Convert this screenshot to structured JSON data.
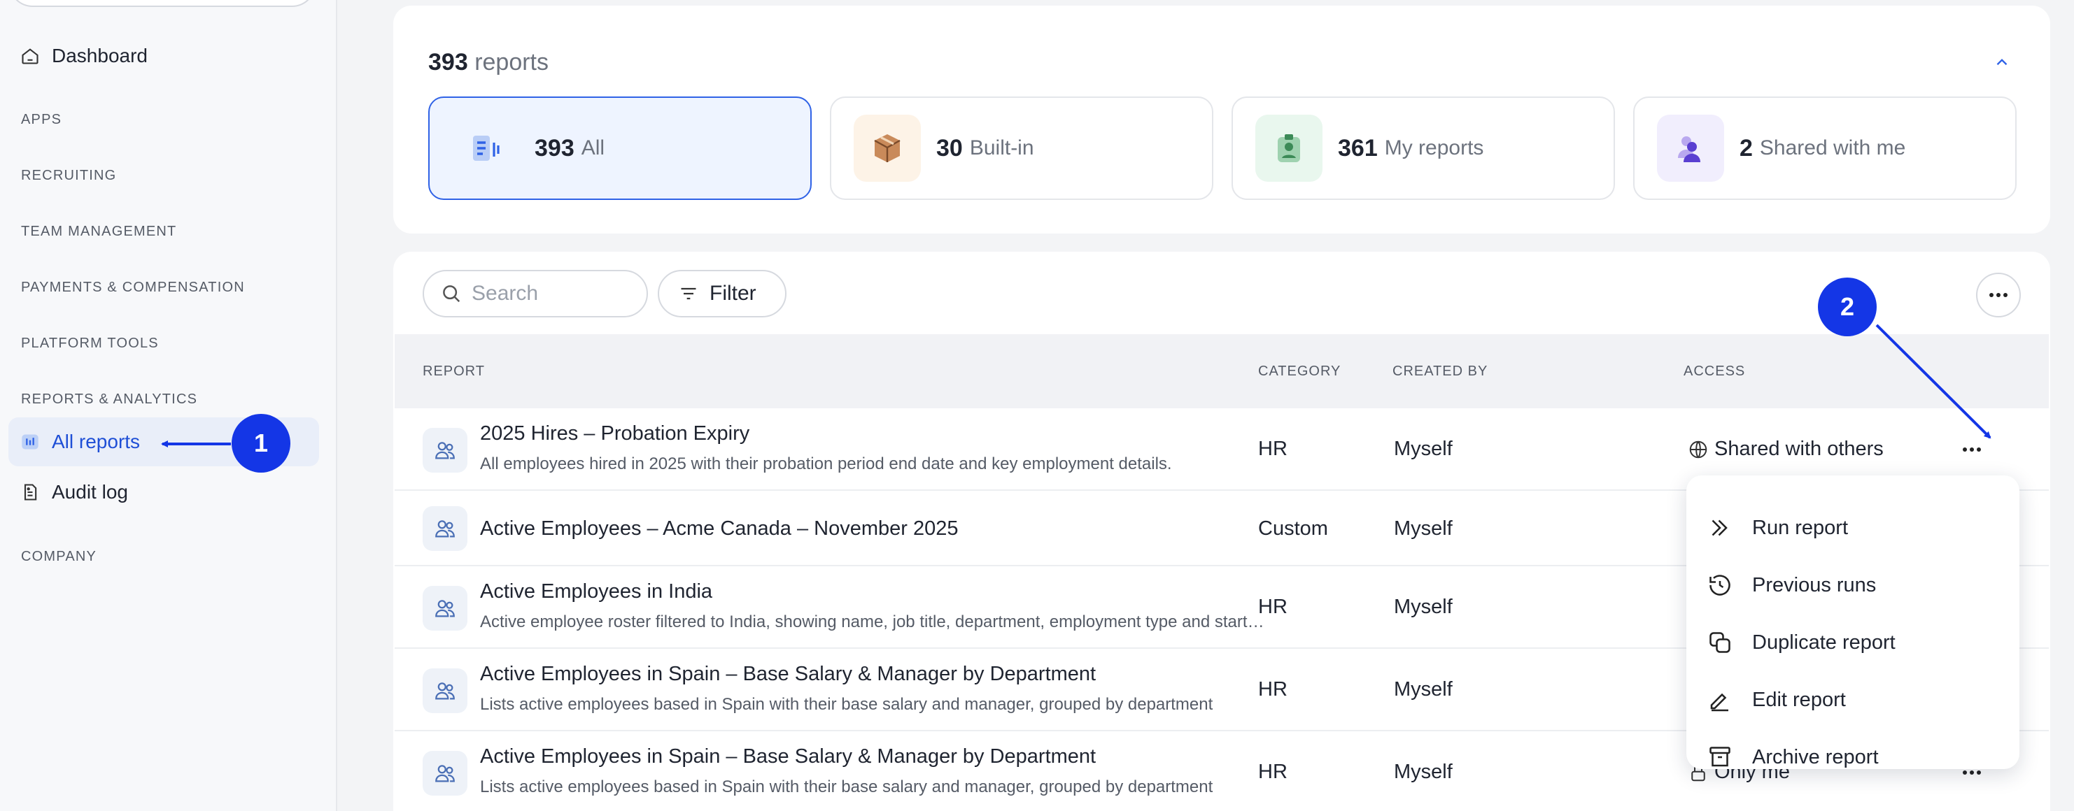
{
  "sidebar": {
    "dashboard": "Dashboard",
    "sections": [
      "APPS",
      "RECRUITING",
      "TEAM MANAGEMENT",
      "PAYMENTS & COMPENSATION",
      "PLATFORM TOOLS",
      "REPORTS & ANALYTICS"
    ],
    "all_reports": "All reports",
    "audit_log": "Audit log",
    "company": "COMPANY"
  },
  "summary": {
    "count": "393",
    "label": "reports",
    "tiles": [
      {
        "count": "393",
        "label": "All"
      },
      {
        "count": "30",
        "label": "Built-in"
      },
      {
        "count": "361",
        "label": "My reports"
      },
      {
        "count": "2",
        "label": "Shared with me"
      }
    ]
  },
  "toolbar": {
    "search_placeholder": "Search",
    "filter_label": "Filter"
  },
  "table": {
    "headers": {
      "report": "REPORT",
      "category": "CATEGORY",
      "created_by": "CREATED BY",
      "access": "ACCESS"
    },
    "rows": [
      {
        "title": "2025 Hires – Probation Expiry",
        "desc": "All employees hired in 2025 with their probation period end date and key employment details.",
        "category": "HR",
        "created_by": "Myself",
        "access": "Shared with others"
      },
      {
        "title": "Active Employees – Acme Canada – November 2025",
        "desc": "",
        "category": "Custom",
        "created_by": "Myself",
        "access": ""
      },
      {
        "title": "Active Employees in India",
        "desc": "Active employee roster filtered to India, showing name, job title, department, employment type and start date",
        "category": "HR",
        "created_by": "Myself",
        "access": ""
      },
      {
        "title": "Active Employees in Spain – Base Salary & Manager by Department",
        "desc": "Lists active employees based in Spain with their base salary and manager, grouped by department",
        "category": "HR",
        "created_by": "Myself",
        "access": ""
      },
      {
        "title": "Active Employees in Spain – Base Salary & Manager by Department",
        "desc": "Lists active employees based in Spain with their base salary and manager, grouped by department",
        "category": "HR",
        "created_by": "Myself",
        "access": "Only me"
      }
    ]
  },
  "menu": {
    "items": [
      "Run report",
      "Previous runs",
      "Duplicate report",
      "Edit report",
      "Archive report"
    ]
  },
  "callouts": {
    "one": "1",
    "two": "2"
  },
  "colors": {
    "accent": "#2f62e6",
    "callout": "#1436e6",
    "active_bg": "#eef4ff"
  }
}
